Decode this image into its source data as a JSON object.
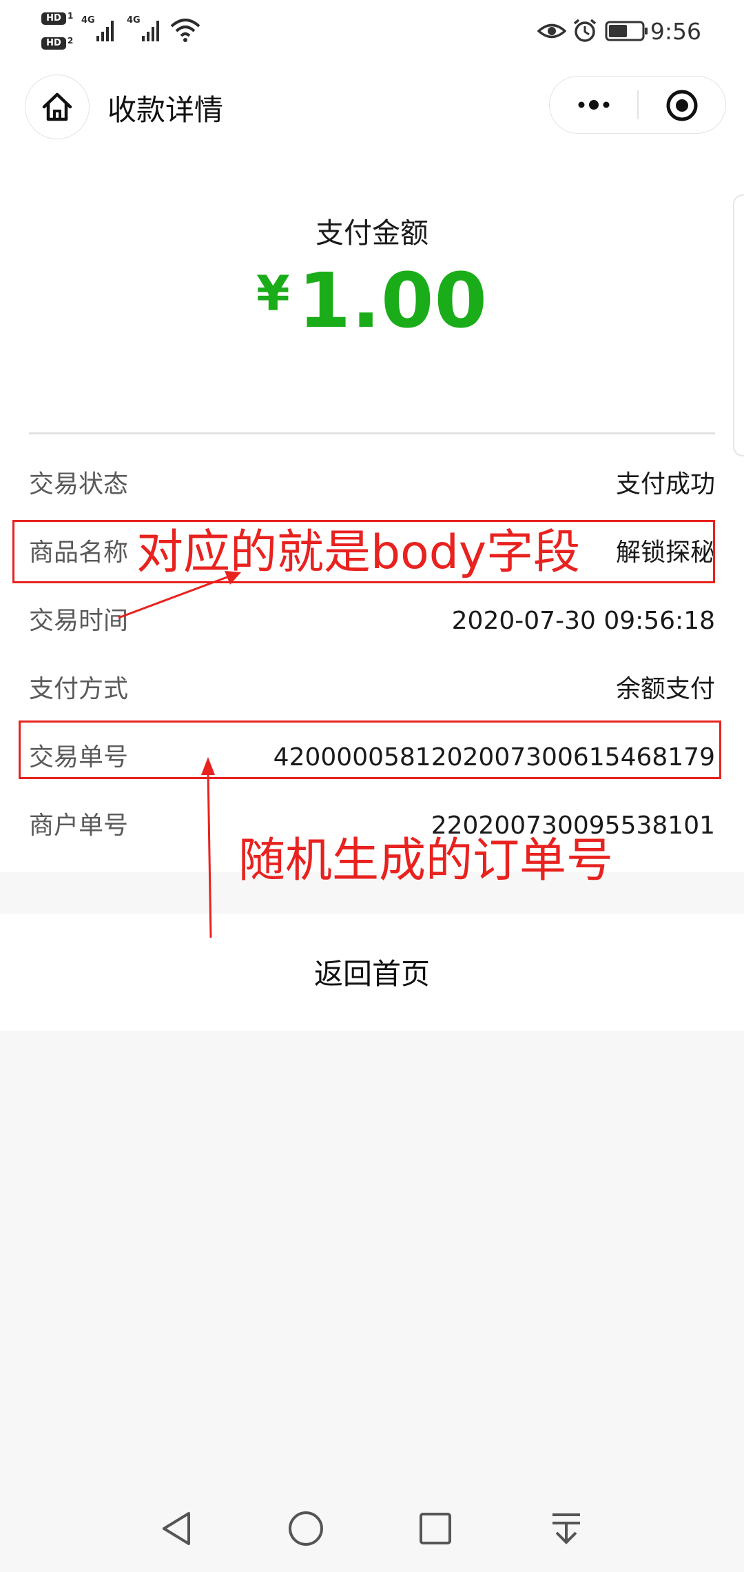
{
  "status_bar": {
    "hd_1": "HD",
    "hd_1_index": "1",
    "hd_2": "HD",
    "hd_2_index": "2",
    "network_1": "4G",
    "network_2": "4G",
    "time": "9:56"
  },
  "title_bar": {
    "title": "收款详情"
  },
  "payment": {
    "amount_label": "支付金额",
    "currency": "¥",
    "amount": "1.00"
  },
  "details": [
    {
      "label": "交易状态",
      "value": "支付成功"
    },
    {
      "label": "商品名称",
      "value": "解锁探秘"
    },
    {
      "label": "交易时间",
      "value": "2020-07-30 09:56:18"
    },
    {
      "label": "支付方式",
      "value": "余额支付"
    },
    {
      "label": "交易单号",
      "value": "4200000581202007300615468179"
    },
    {
      "label": "商户单号",
      "value": "220200730095538101"
    }
  ],
  "actions": {
    "return_home": "返回首页"
  },
  "annotations": {
    "body_field": "对应的就是body字段",
    "random_order": "随机生成的订单号"
  },
  "colors": {
    "accent_green": "#1aad19",
    "annotation_red": "#e8221f"
  }
}
